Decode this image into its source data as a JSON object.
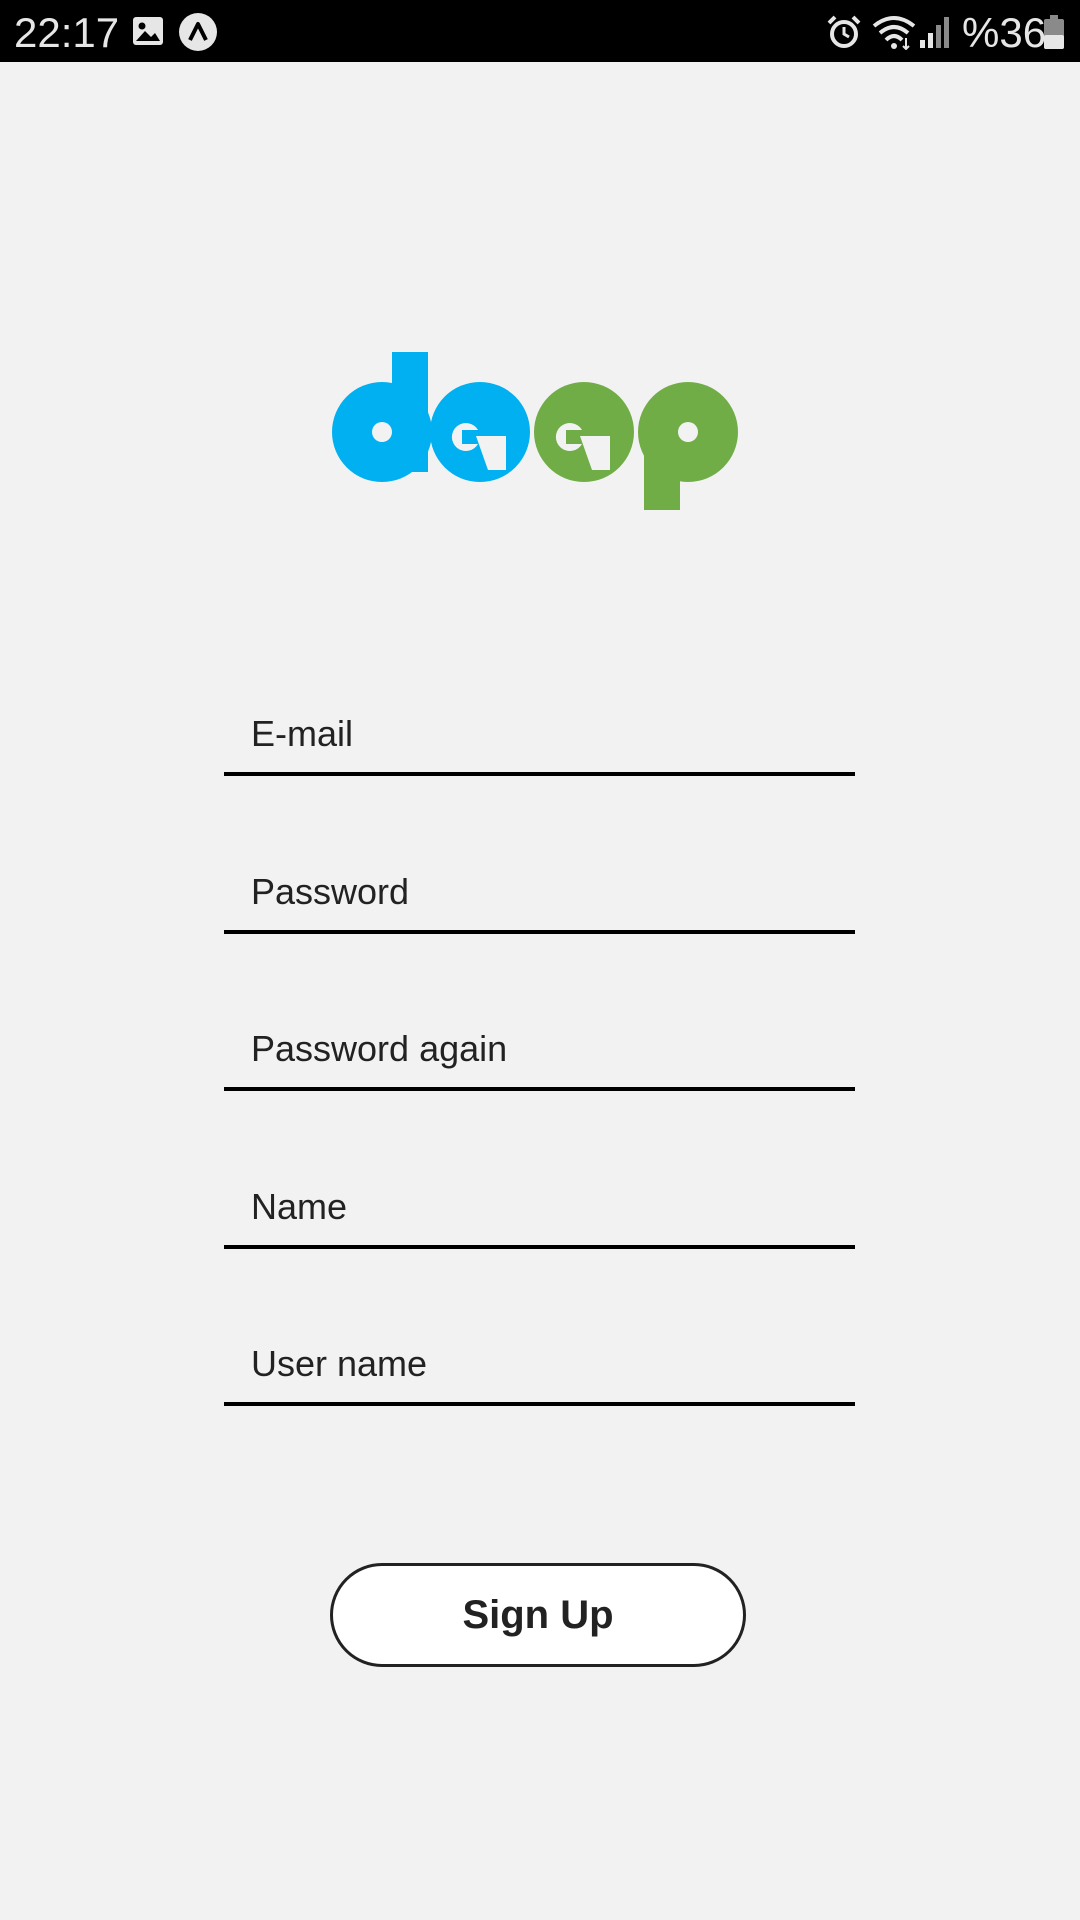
{
  "status_bar": {
    "time": "22:17",
    "battery_text": "%36",
    "icons": [
      "image-notification-icon",
      "app-notification-icon",
      "alarm-icon",
      "wifi-icon",
      "signal-icon",
      "battery-icon"
    ]
  },
  "logo": {
    "letters": [
      "d",
      "e",
      "e",
      "p"
    ],
    "colors": {
      "blue": "#00b0f0",
      "green": "#70ad47"
    }
  },
  "form": {
    "email_placeholder": "E-mail",
    "password_placeholder": "Password",
    "password_again_placeholder": "Password again",
    "name_placeholder": "Name",
    "username_placeholder": "User name",
    "submit_label": "Sign Up"
  }
}
